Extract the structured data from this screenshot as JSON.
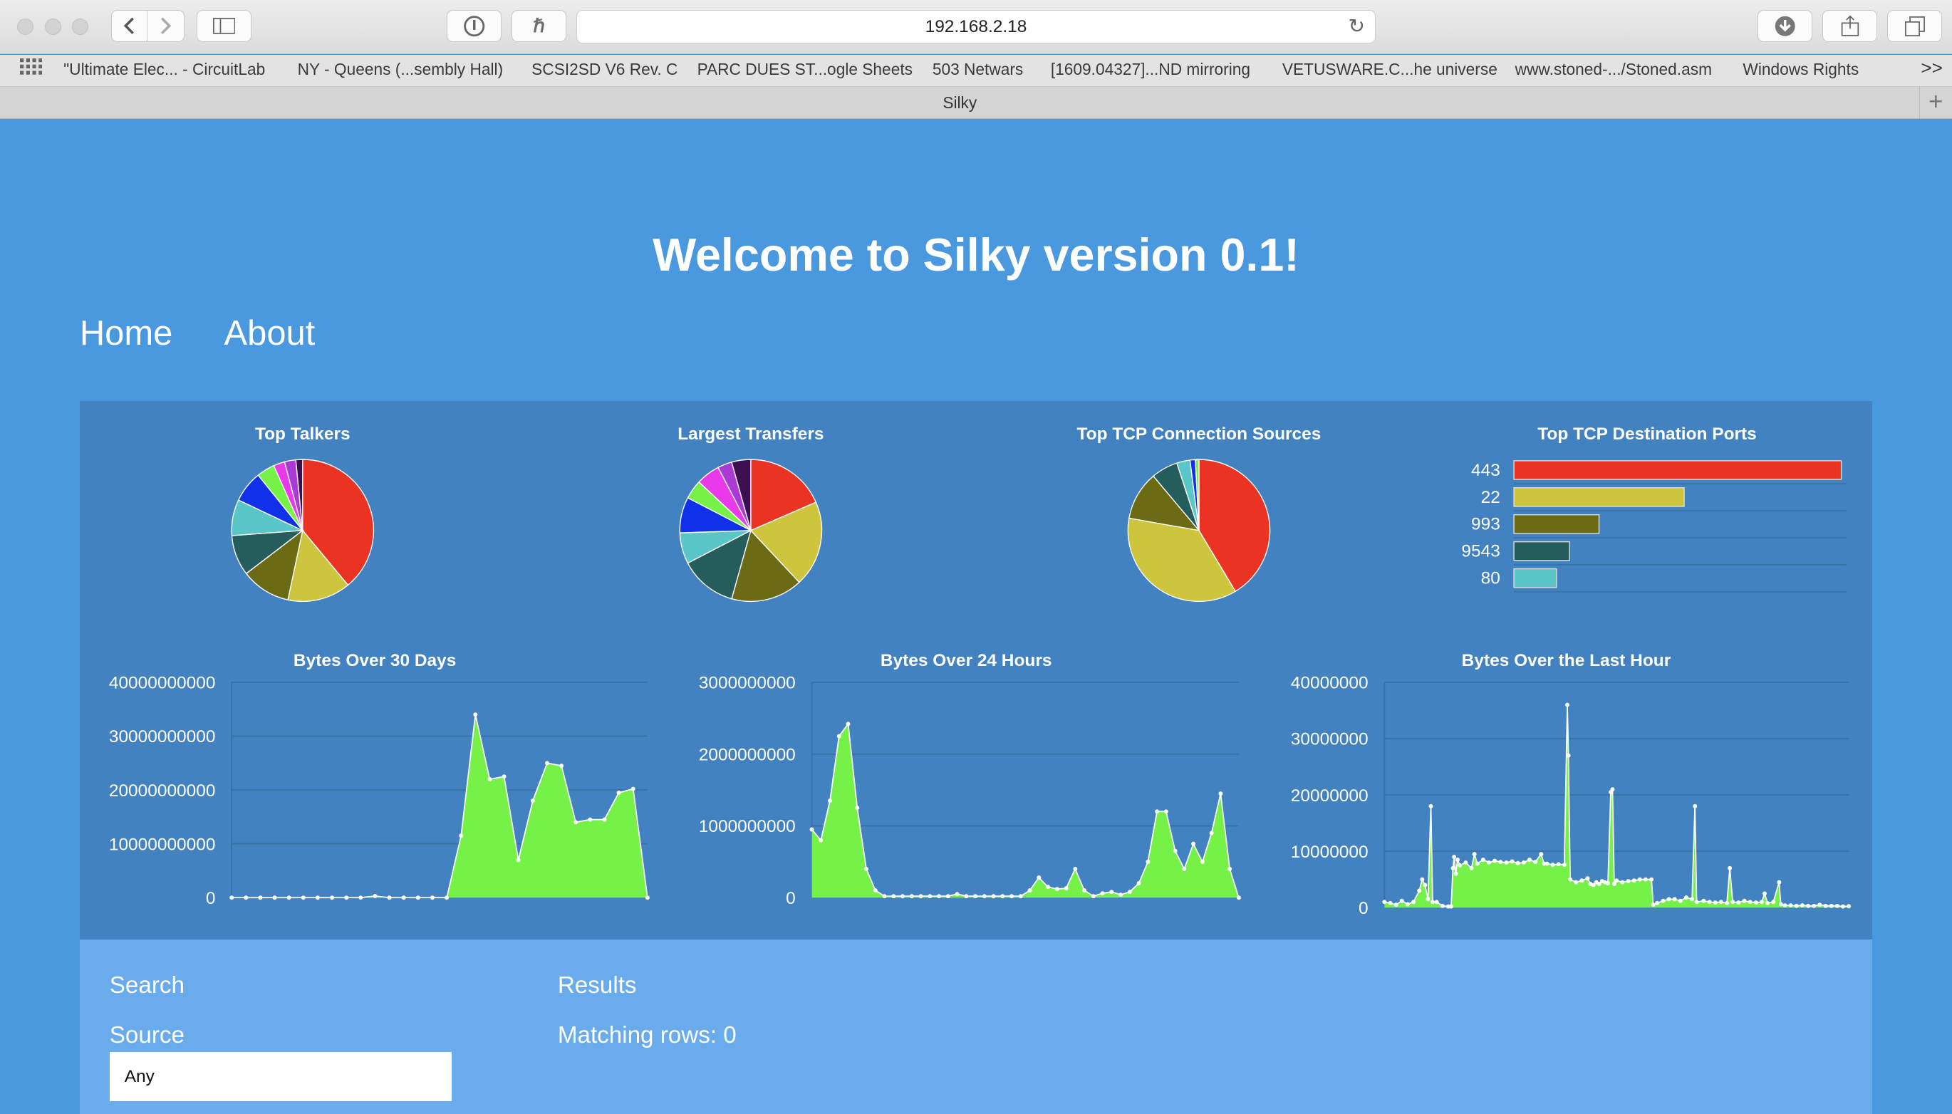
{
  "browser": {
    "url": "192.168.2.18",
    "tab_title": "Silky",
    "bookmarks": [
      "\"Ultimate Elec... - CircuitLab",
      "NY - Queens (...sembly Hall)",
      "SCSI2SD V6 Rev. C",
      "PARC DUES ST...ogle Sheets",
      "503 Netwars",
      "[1609.04327]...ND mirroring",
      "VETUSWARE.C...he universe",
      "www.stoned-.../Stoned.asm",
      "Windows Rights"
    ],
    "overflow": ">>",
    "icons": [
      "back-icon",
      "forward-icon",
      "sidebar-icon",
      "password-icon",
      "honey-icon",
      "reload-icon",
      "download-icon",
      "share-icon",
      "tabs-icon",
      "apps-grid-icon",
      "new-tab-icon"
    ]
  },
  "page": {
    "title": "Welcome to Silky version 0.1!",
    "nav": {
      "home": "Home",
      "about": "About"
    },
    "search": {
      "heading": "Search",
      "source_label": "Source",
      "source_value": "Any",
      "results_heading": "Results",
      "matching_rows": "Matching rows: 0"
    }
  },
  "palette": [
    "#ea3323",
    "#cdc53d",
    "#6c6b15",
    "#255c5c",
    "#5bc6c7",
    "#1030ea",
    "#75f148",
    "#e83ae8",
    "#a93ad4",
    "#3c0f50",
    "#ffffff"
  ],
  "chart_data": [
    {
      "type": "pie",
      "title": "Top Talkers",
      "values": [
        38,
        14,
        11,
        9,
        8,
        7,
        4,
        2.5,
        2.5,
        1.5
      ]
    },
    {
      "type": "pie",
      "title": "Largest Transfers",
      "values": [
        17,
        18,
        15,
        12,
        6.5,
        7.5,
        4,
        5,
        3,
        4
      ]
    },
    {
      "type": "pie",
      "title": "Top TCP Connection Sources",
      "values": [
        41,
        36,
        11,
        6,
        3,
        1.2,
        0.8
      ]
    },
    {
      "type": "bar",
      "title": "Top TCP Destination Ports",
      "orientation": "horizontal",
      "categories": [
        "443",
        "22",
        "993",
        "9543",
        "80"
      ],
      "values": [
        100,
        52,
        26,
        17,
        13
      ]
    },
    {
      "type": "area",
      "title": "Bytes Over 30 Days",
      "ylim": [
        0,
        40000000000
      ],
      "yticks": [
        0,
        10000000000,
        20000000000,
        30000000000,
        40000000000
      ],
      "y_tick_labels": [
        "0",
        "10000000000",
        "20000000000",
        "30000000000",
        "40000000000"
      ],
      "values": [
        0,
        0,
        0,
        0,
        0,
        0,
        0,
        0,
        0,
        9000000,
        300000000,
        0,
        0,
        0,
        0,
        0,
        11500000000,
        34000000000,
        22000000000,
        22500000000,
        7000000000,
        18000000000,
        25000000000,
        24500000000,
        14000000000,
        14500000000,
        14500000000,
        19500000000,
        20200000000,
        0
      ]
    },
    {
      "type": "area",
      "title": "Bytes Over 24 Hours",
      "ylim": [
        0,
        3000000000
      ],
      "yticks": [
        0,
        1000000000,
        2000000000,
        3000000000
      ],
      "y_tick_labels": [
        "0",
        "1000000000",
        "2000000000",
        "3000000000"
      ],
      "values": [
        950000000,
        800000000,
        1350000000,
        2250000000,
        2420000000,
        1250000000,
        400000000,
        100000000,
        20000000,
        20000000,
        20000000,
        20000000,
        20000000,
        20000000,
        20000000,
        20000000,
        50000000,
        20000000,
        20000000,
        20000000,
        20000000,
        20000000,
        20000000,
        20000000,
        100000000,
        280000000,
        150000000,
        120000000,
        130000000,
        400000000,
        100000000,
        20000000,
        60000000,
        80000000,
        40000000,
        80000000,
        200000000,
        500000000,
        1200000000,
        1200000000,
        650000000,
        400000000,
        750000000,
        500000000,
        900000000,
        1450000000,
        400000000,
        0
      ]
    },
    {
      "type": "area",
      "title": "Bytes Over the Last Hour",
      "ylim": [
        0,
        40000000
      ],
      "yticks": [
        0,
        10000000,
        20000000,
        30000000,
        40000000
      ],
      "y_tick_labels": [
        "0",
        "10000000",
        "20000000",
        "30000000",
        "40000000"
      ],
      "points": [
        [
          0,
          1000000
        ],
        [
          1,
          800000
        ],
        [
          2,
          500000
        ],
        [
          3,
          1200000
        ],
        [
          4,
          600000
        ],
        [
          5,
          1000000
        ],
        [
          6,
          3000000
        ],
        [
          6.5,
          5000000
        ],
        [
          7,
          4000000
        ],
        [
          7.5,
          1500000
        ],
        [
          8,
          18000000
        ],
        [
          8.3,
          1000000
        ],
        [
          9,
          1000000
        ],
        [
          10,
          300000
        ],
        [
          11,
          200000
        ],
        [
          11.5,
          200000
        ],
        [
          11.8,
          7000000
        ],
        [
          12,
          9000000
        ],
        [
          12.3,
          6000000
        ],
        [
          12.6,
          8500000
        ],
        [
          13,
          7500000
        ],
        [
          14,
          8000000
        ],
        [
          15,
          7000000
        ],
        [
          15.5,
          9500000
        ],
        [
          16,
          7800000
        ],
        [
          17,
          8500000
        ],
        [
          18,
          8000000
        ],
        [
          19,
          8300000
        ],
        [
          20,
          8100000
        ],
        [
          21,
          8000000
        ],
        [
          22,
          8200000
        ],
        [
          23,
          7900000
        ],
        [
          24,
          8000000
        ],
        [
          25,
          8500000
        ],
        [
          26,
          8100000
        ],
        [
          27,
          9500000
        ],
        [
          27.5,
          7800000
        ],
        [
          28,
          7800000
        ],
        [
          29,
          7600000
        ],
        [
          30,
          7700000
        ],
        [
          31,
          7600000
        ],
        [
          31.5,
          36000000
        ],
        [
          31.7,
          27000000
        ],
        [
          32,
          5000000
        ],
        [
          33,
          4500000
        ],
        [
          34,
          4800000
        ],
        [
          35,
          5200000
        ],
        [
          35.5,
          4200000
        ],
        [
          36,
          4000000
        ],
        [
          36.5,
          4500000
        ],
        [
          37,
          4200000
        ],
        [
          37.5,
          4700000
        ],
        [
          38,
          4500000
        ],
        [
          38.5,
          4300000
        ],
        [
          39,
          20500000
        ],
        [
          39.3,
          21000000
        ],
        [
          39.6,
          4200000
        ],
        [
          40,
          4800000
        ],
        [
          41,
          4500000
        ],
        [
          42,
          4700000
        ],
        [
          43,
          4800000
        ],
        [
          44,
          5000000
        ],
        [
          45,
          5000000
        ],
        [
          46,
          5000000
        ],
        [
          46.3,
          500000
        ],
        [
          47,
          800000
        ],
        [
          48,
          1200000
        ],
        [
          49,
          1500000
        ],
        [
          50,
          1500000
        ],
        [
          51,
          1200000
        ],
        [
          52,
          1800000
        ],
        [
          53,
          1500000
        ],
        [
          53.5,
          18000000
        ],
        [
          53.8,
          1000000
        ],
        [
          55,
          1200000
        ],
        [
          56,
          1000000
        ],
        [
          57,
          900000
        ],
        [
          58,
          1000000
        ],
        [
          59,
          800000
        ],
        [
          59.5,
          7000000
        ],
        [
          60,
          1000000
        ],
        [
          61,
          900000
        ],
        [
          62,
          1200000
        ],
        [
          63,
          1000000
        ],
        [
          64,
          900000
        ],
        [
          65,
          1000000
        ],
        [
          65.5,
          2500000
        ],
        [
          66,
          800000
        ],
        [
          67,
          1000000
        ],
        [
          68,
          4500000
        ],
        [
          68.3,
          600000
        ],
        [
          69,
          400000
        ],
        [
          70,
          400000
        ],
        [
          71,
          300000
        ],
        [
          72,
          400000
        ],
        [
          73,
          300000
        ],
        [
          74,
          300000
        ],
        [
          75,
          500000
        ],
        [
          76,
          300000
        ],
        [
          77,
          300000
        ],
        [
          78,
          300000
        ],
        [
          79,
          200000
        ],
        [
          80,
          250000
        ]
      ],
      "x_extent": [
        0,
        80
      ]
    }
  ]
}
